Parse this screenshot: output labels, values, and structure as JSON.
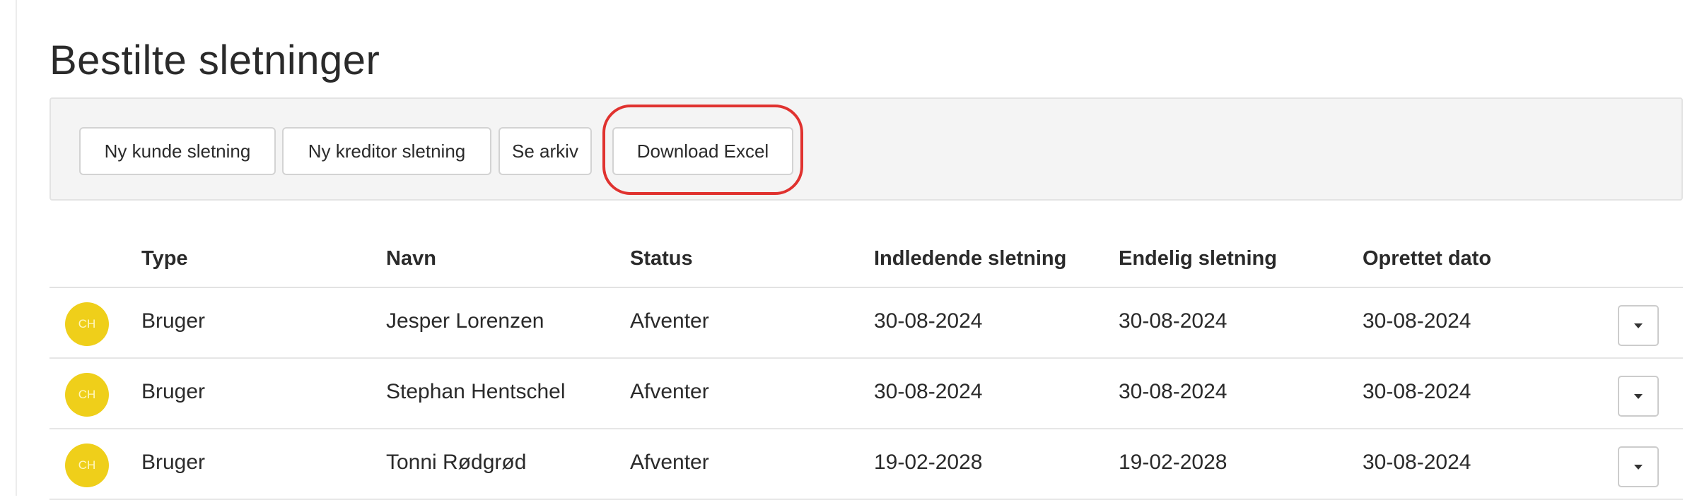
{
  "page": {
    "title": "Bestilte sletninger"
  },
  "toolbar": {
    "buttons": [
      {
        "label": "Ny kunde sletning"
      },
      {
        "label": "Ny kreditor sletning"
      },
      {
        "label": "Se arkiv"
      },
      {
        "label": "Download Excel"
      }
    ],
    "highlight_color": "#e0322f"
  },
  "table": {
    "columns": [
      "Type",
      "Navn",
      "Status",
      "Indledende sletning",
      "Endelig sletning",
      "Oprettet dato"
    ],
    "rows": [
      {
        "avatar": "CH",
        "type": "Bruger",
        "name": "Jesper Lorenzen",
        "status": "Afventer",
        "initial": "30-08-2024",
        "final": "30-08-2024",
        "created": "30-08-2024"
      },
      {
        "avatar": "CH",
        "type": "Bruger",
        "name": "Stephan Hentschel",
        "status": "Afventer",
        "initial": "30-08-2024",
        "final": "30-08-2024",
        "created": "30-08-2024"
      },
      {
        "avatar": "CH",
        "type": "Bruger",
        "name": "Tonni Rødgrød",
        "status": "Afventer",
        "initial": "19-02-2028",
        "final": "19-02-2028",
        "created": "30-08-2024"
      }
    ],
    "row_action_icon": "caret-down-icon"
  },
  "colors": {
    "avatar_bg": "#efcf1a",
    "toolbar_bg": "#f4f4f4"
  }
}
